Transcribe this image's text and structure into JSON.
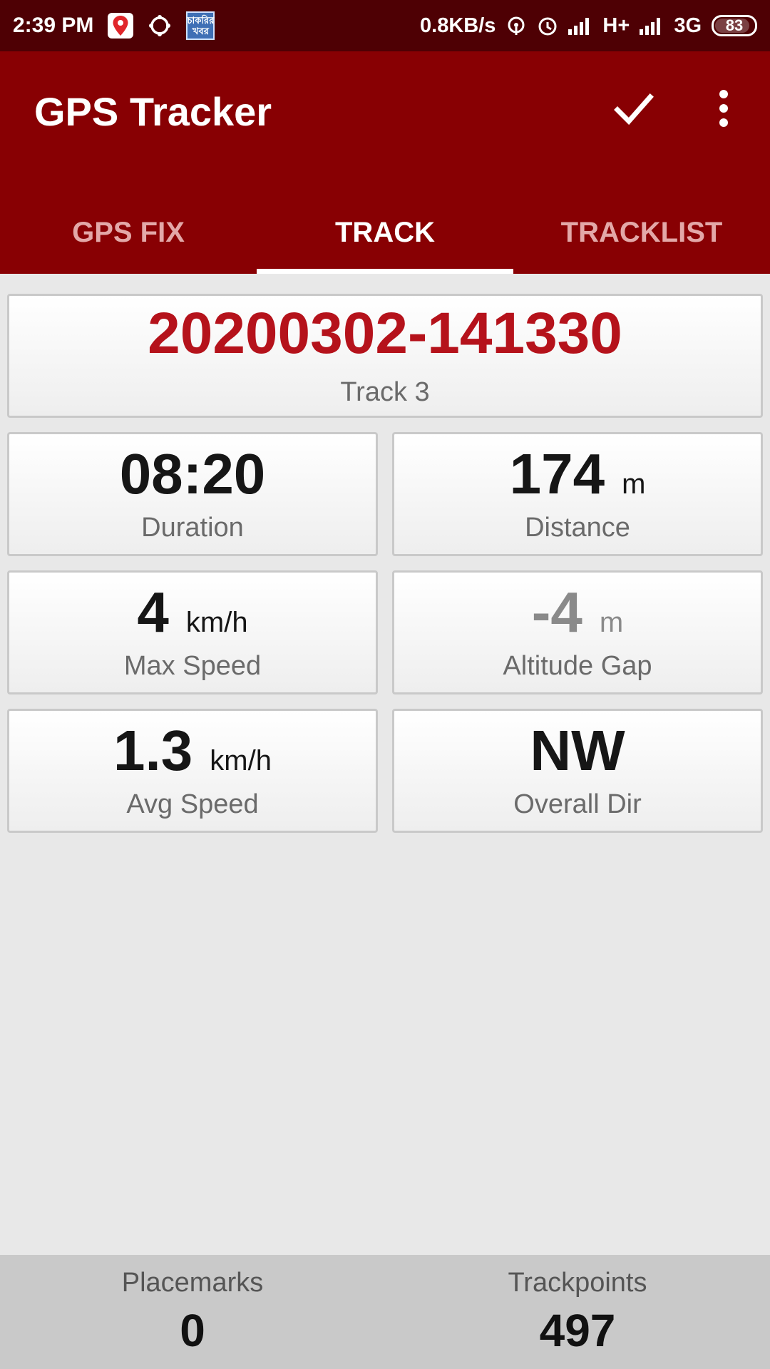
{
  "status_bar": {
    "time": "2:39 PM",
    "net_speed": "0.8KB/s",
    "network_1": "H+",
    "network_2": "3G",
    "battery": "83",
    "news_badge_text": "চাকরির খবর"
  },
  "app": {
    "title": "GPS Tracker",
    "accent_color": "#880003"
  },
  "tabs": [
    {
      "label": "GPS FIX",
      "active": false
    },
    {
      "label": "TRACK",
      "active": true
    },
    {
      "label": "TRACKLIST",
      "active": false
    }
  ],
  "track": {
    "id": "20200302-141330",
    "name": "Track 3"
  },
  "stats": {
    "duration": {
      "value": "08:20",
      "label": "Duration"
    },
    "distance": {
      "value": "174",
      "unit": "m",
      "label": "Distance"
    },
    "max_speed": {
      "value": "4",
      "unit": "km/h",
      "label": "Max Speed"
    },
    "altitude_gap": {
      "value": "-4",
      "unit": "m",
      "label": "Altitude Gap"
    },
    "avg_speed": {
      "value": "1.3",
      "unit": "km/h",
      "label": "Avg Speed"
    },
    "overall_dir": {
      "value": "NW",
      "label": "Overall Dir"
    }
  },
  "footer": {
    "placemarks_label": "Placemarks",
    "placemarks_value": "0",
    "trackpoints_label": "Trackpoints",
    "trackpoints_value": "497"
  }
}
